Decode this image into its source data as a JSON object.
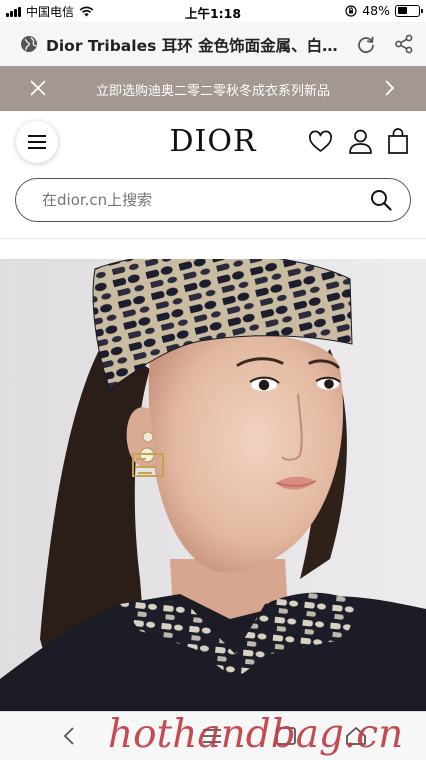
{
  "status_bar": {
    "carrier": "中国电信",
    "time": "上午1:18",
    "battery_percent_text": "48%",
    "battery_level": 0.48,
    "icons": [
      "signal-icon",
      "wifi-icon",
      "rotation-lock-icon",
      "battery-icon"
    ]
  },
  "browser": {
    "page_title": "Dior Tribales 耳环 金色饰面金属、白…",
    "icons": [
      "globe-icon",
      "reload-icon",
      "share-icon"
    ]
  },
  "promo": {
    "text": "立即选购迪奥二零二零秋冬成衣系列新品",
    "icons": [
      "close-icon",
      "chevron-right-icon"
    ]
  },
  "header": {
    "logo": "DIOR",
    "icons": [
      "menu-icon",
      "heart-icon",
      "user-icon",
      "shopping-bag-icon"
    ]
  },
  "search": {
    "placeholder": "在dior.cn上搜索",
    "icon": "search-icon"
  },
  "hero": {
    "alt_visual": "model wearing Dior Oblique headscarf and Dior Tribales earring"
  },
  "bottom_bar": {
    "icons": [
      "back-icon",
      "menu-icon",
      "tabs-icon",
      "home-icon"
    ]
  },
  "watermark": "hothandbag.cn",
  "colors": {
    "promo_bg": "#a29791",
    "watermark": "#c13d45",
    "title_bar_bg": "#f6f6f6"
  }
}
